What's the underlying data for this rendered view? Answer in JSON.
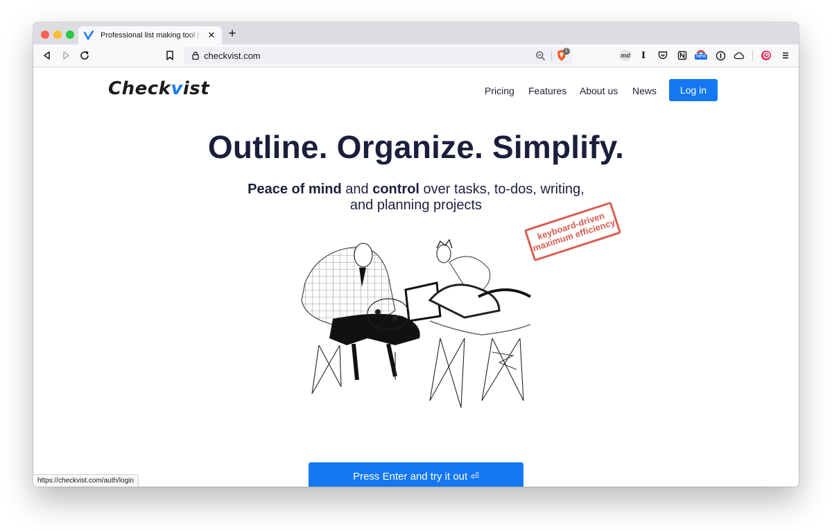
{
  "browser": {
    "tab_title": "Professional list making tool | Checkvist",
    "tab_close": "✕",
    "new_tab": "+",
    "url": "checkvist.com",
    "brave_badge": "1",
    "extension_md": "md",
    "extension_new_badge": "New",
    "status_url": "https://checkvist.com/auth/login",
    "icons": [
      "back-icon",
      "forward-icon",
      "reload-icon",
      "bookmark-icon",
      "lock-icon",
      "zoom-icon",
      "brave-shield-icon",
      "markdown-icon",
      "cursor-icon",
      "pocket-icon",
      "notion-icon",
      "chrome-ext-icon",
      "onepassword-icon",
      "cloud-icon",
      "extension-spiral-icon",
      "menu-icon"
    ]
  },
  "site": {
    "logo_pre": "Check",
    "logo_v": "v",
    "logo_post": "ist",
    "nav": [
      "Pricing",
      "Features",
      "About us",
      "News"
    ],
    "login": "Log in",
    "headline": "Outline. Organize. Simplify.",
    "sub_bold1": "Peace of mind",
    "sub_mid1": " and ",
    "sub_bold2": "control",
    "sub_rest1": " over tasks, to-dos, writing,",
    "sub_line2": "and planning projects",
    "stamp_line1": "keyboard-driven",
    "stamp_line2": "maximum efficiency",
    "cta": "Press Enter and try it out ⏎"
  },
  "colors": {
    "accent": "#1577f2",
    "heading": "#1c1f3b",
    "stamp": "#d6463a"
  }
}
